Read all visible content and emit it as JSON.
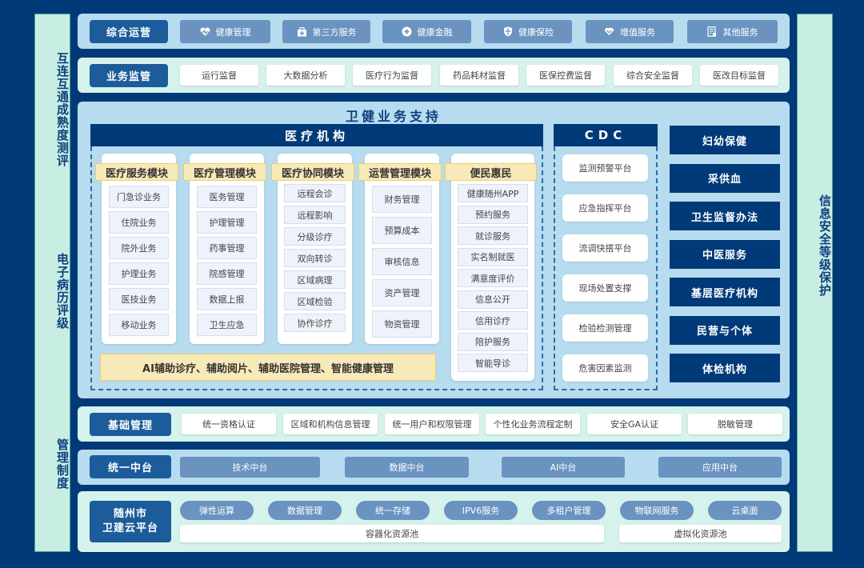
{
  "left_sidebar": {
    "sections": [
      "互连互通成熟度测评",
      "电子病历评级",
      "管理制度"
    ]
  },
  "right_sidebar": {
    "label": "信息安全等级保护"
  },
  "ops_row": {
    "label": "综合运营",
    "items": [
      {
        "label": "健康管理",
        "icon": "heart-pulse-icon"
      },
      {
        "label": "第三方服务",
        "icon": "medkit-icon"
      },
      {
        "label": "健康金融",
        "icon": "plus-circle-icon"
      },
      {
        "label": "健康保险",
        "icon": "shield-icon"
      },
      {
        "label": "增值服务",
        "icon": "diamond-icon"
      },
      {
        "label": "其他服务",
        "icon": "document-icon"
      }
    ]
  },
  "supervision_row": {
    "label": "业务监管",
    "items": [
      "运行监督",
      "大数据分析",
      "医疗行为监督",
      "药品耗材监督",
      "医保控费监督",
      "综合安全监督",
      "医改目标监督"
    ]
  },
  "support": {
    "title": "卫健业务支持",
    "medical": {
      "title": "医疗机构",
      "modules": [
        {
          "title": "医疗服务模块",
          "items": [
            "门急诊业务",
            "住院业务",
            "院外业务",
            "护理业务",
            "医技业务",
            "移动业务"
          ]
        },
        {
          "title": "医疗管理模块",
          "items": [
            "医务管理",
            "护理管理",
            "药事管理",
            "院感管理",
            "数据上报",
            "卫生应急"
          ]
        },
        {
          "title": "医疗协同模块",
          "items": [
            "远程会诊",
            "远程影响",
            "分级诊疗",
            "双向转诊",
            "区域病理",
            "区域检验",
            "协作诊疗"
          ]
        },
        {
          "title": "运营管理模块",
          "items": [
            "财务管理",
            "预算成本",
            "审核信息",
            "资产管理",
            "物资管理"
          ]
        },
        {
          "title": "便民惠民",
          "items": [
            "健康随州APP",
            "预约服务",
            "就诊服务",
            "实名制就医",
            "满意度评价",
            "信息公开",
            "信用诊疗",
            "陪护服务",
            "智能导诊"
          ]
        }
      ],
      "ai_bar": "AI辅助诊疗、辅助阅片、辅助医院管理、智能健康管理"
    },
    "cdc": {
      "title": "CDC",
      "items": [
        "监测预警平台",
        "应急指挥平台",
        "流调快搭平台",
        "现场处置支撑",
        "检验检测管理",
        "危害因素监测"
      ]
    },
    "others": [
      "妇幼保健",
      "采供血",
      "卫生监督办法",
      "中医服务",
      "基层医疗机构",
      "民营与个体",
      "体检机构"
    ]
  },
  "base_row": {
    "label": "基础管理",
    "items": [
      "统一资格认证",
      "区域和机构信息管理",
      "统一用户和权限管理",
      "个性化业务流程定制",
      "安全GA认证",
      "脱敏管理"
    ]
  },
  "middle_row": {
    "label": "统一中台",
    "items": [
      "技术中台",
      "数据中台",
      "AI中台",
      "应用中台"
    ]
  },
  "cloud_row": {
    "label_line1": "随州市",
    "label_line2": "卫建云平台",
    "services": [
      "弹性运算",
      "数据管理",
      "统一存储",
      "IPV6服务",
      "多租户管理",
      "物联网服务",
      "云桌面"
    ],
    "pools": [
      "容器化资源池",
      "虚拟化资源池"
    ]
  },
  "colors": {
    "background": "#003a78",
    "label_blue": "#1d5c9b",
    "steel_chip": "#6a93c0",
    "band_blue": "#b7dcef",
    "band_mint": "#d6f2ec",
    "module_header": "#f8e9b8",
    "sidebar": "#c8eee4"
  }
}
